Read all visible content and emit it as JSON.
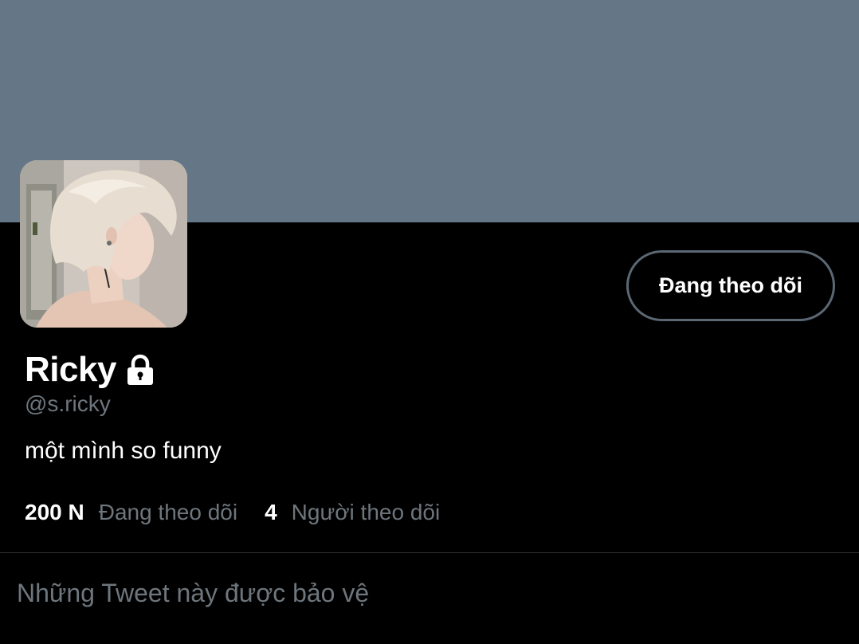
{
  "profile": {
    "display_name": "Ricky",
    "handle": "@s.ricky",
    "bio": "một mình so funny",
    "lock_icon": "lock-icon",
    "follow_button_label": "Đang theo dõi"
  },
  "stats": {
    "following_count": "200 N",
    "following_label": "Đang theo dõi",
    "followers_count": "4",
    "followers_label": "Người theo dõi"
  },
  "protected_notice": "Những Tweet này được bảo vệ",
  "colors": {
    "banner": "#657786",
    "background": "#000000",
    "secondary_text": "#6e767d",
    "button_border": "#5b6874"
  }
}
